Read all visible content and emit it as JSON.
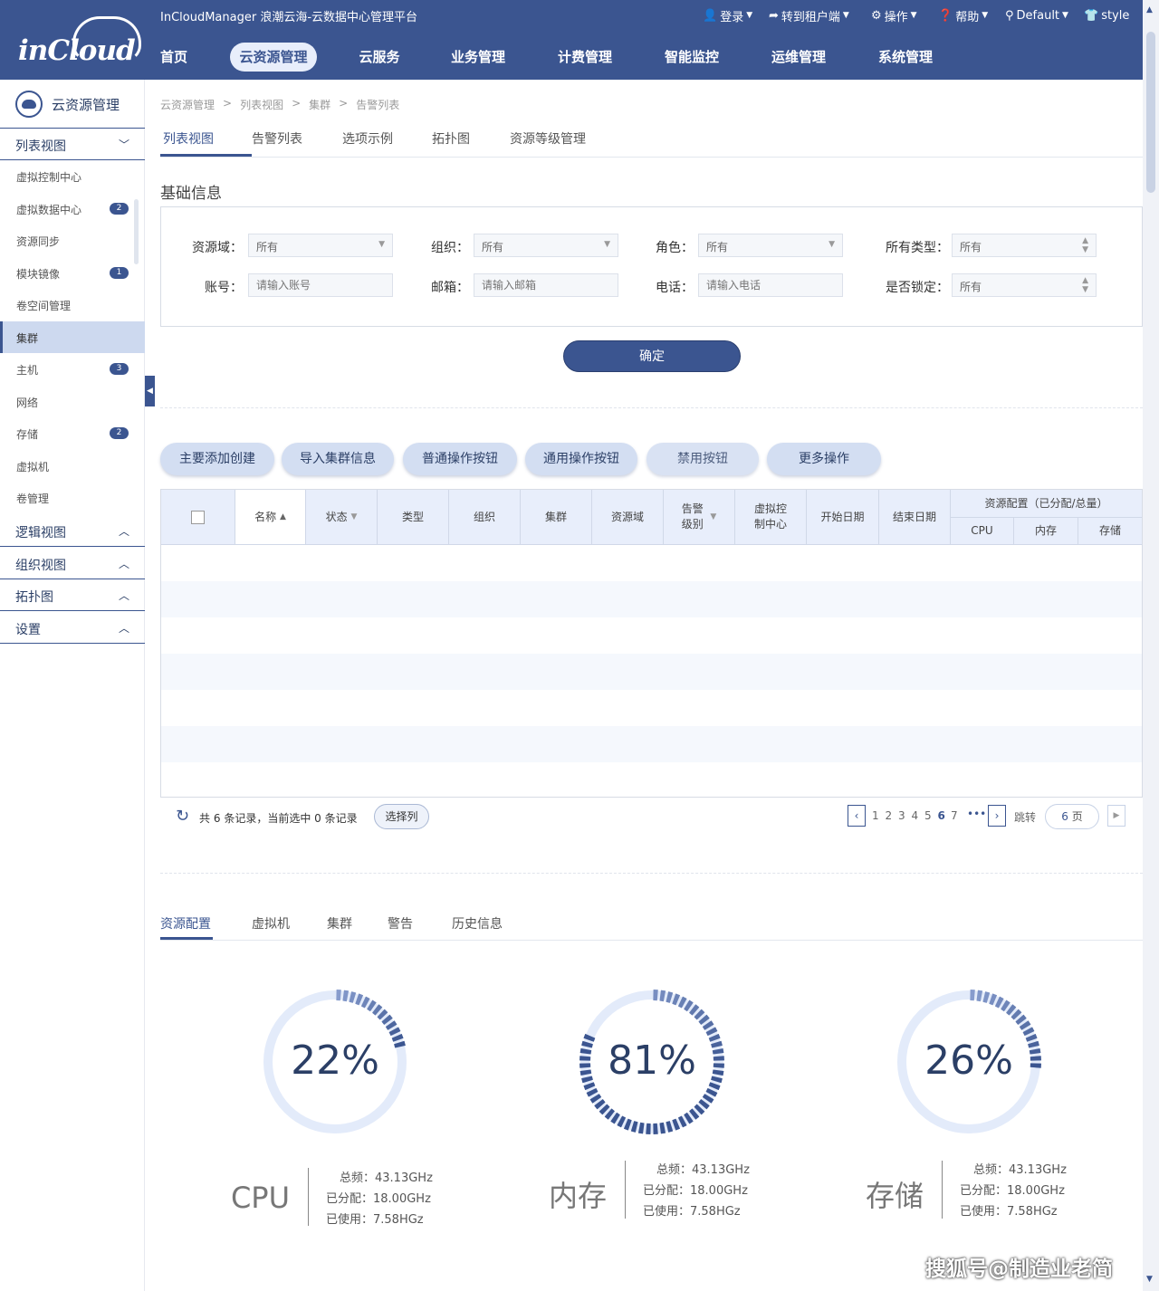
{
  "app": {
    "logo_text": "inCloud",
    "platform_title": "InCloudManager 浪潮云海-云数据中心管理平台"
  },
  "topbar": {
    "login": "登录",
    "tenant": "转到租户端",
    "ops": "操作",
    "help": "帮助",
    "location": "Default",
    "style": "style"
  },
  "mainnav": [
    "首页",
    "云资源管理",
    "云服务",
    "业务管理",
    "计费管理",
    "智能监控",
    "运维管理",
    "系统管理"
  ],
  "sidebar": {
    "title": "云资源管理",
    "list_view": "列表视图",
    "items": [
      {
        "label": "虚拟控制中心",
        "badge": ""
      },
      {
        "label": "虚拟数据中心",
        "badge": "2"
      },
      {
        "label": "资源同步",
        "badge": ""
      },
      {
        "label": "模块镜像",
        "badge": "1"
      },
      {
        "label": "卷空间管理",
        "badge": ""
      },
      {
        "label": "集群",
        "badge": ""
      },
      {
        "label": "主机",
        "badge": "3"
      },
      {
        "label": "网络",
        "badge": ""
      },
      {
        "label": "存储",
        "badge": "2"
      },
      {
        "label": "虚拟机",
        "badge": ""
      },
      {
        "label": "卷管理",
        "badge": ""
      }
    ],
    "sections": [
      "逻辑视图",
      "组织视图",
      "拓扑图",
      "设置"
    ]
  },
  "breadcrumb": [
    "云资源管理",
    ">",
    "列表视图",
    ">",
    "集群",
    ">",
    "告警列表"
  ],
  "tabs": [
    "列表视图",
    "告警列表",
    "选项示例",
    "拓扑图",
    "资源等级管理"
  ],
  "section_title": "基础信息",
  "filters": {
    "domain": {
      "label": "资源域：",
      "value": "所有"
    },
    "org": {
      "label": "组织：",
      "value": "所有"
    },
    "role": {
      "label": "角色：",
      "value": "所有"
    },
    "type": {
      "label": "所有类型：",
      "value": "所有"
    },
    "account": {
      "label": "账号：",
      "placeholder": "请输入账号"
    },
    "email": {
      "label": "邮箱：",
      "placeholder": "请输入邮箱"
    },
    "phone": {
      "label": "电话：",
      "placeholder": "请输入电话"
    },
    "locked": {
      "label": "是否锁定：",
      "value": "所有"
    }
  },
  "confirm_label": "确定",
  "op_buttons": [
    "主要添加创建",
    "导入集群信息",
    "普通操作按钮",
    "通用操作按钮",
    "禁用按钮",
    "更多操作"
  ],
  "table": {
    "headers": [
      "名称",
      "状态",
      "类型",
      "组织",
      "集群",
      "资源域",
      "告警\n级别",
      "虚拟控\n制中心",
      "开始日期",
      "结束日期"
    ],
    "group_header": "资源配置（已分配/总量）",
    "sub_headers": [
      "CPU",
      "内存",
      "存储"
    ]
  },
  "pager": {
    "summary_prefix": "共",
    "total": "6",
    "summary_mid": "条记录，当前选中",
    "selected": "0",
    "summary_suffix": "条记录",
    "choose_cols": "选择列",
    "pages": [
      "1",
      "2",
      "3",
      "4",
      "5",
      "6",
      "7"
    ],
    "current_page": "6",
    "ellipsis": "•••",
    "jump_label": "跳转",
    "jump_value": "6",
    "jump_unit": "页"
  },
  "res_tabs": [
    "资源配置",
    "虚拟机",
    "集群",
    "警告",
    "历史信息"
  ],
  "resources": [
    {
      "name": "CPU",
      "pct_text": "22%",
      "pct": 0.22,
      "total": "总频：43.13GHz",
      "alloc": "已分配：18.00GHz",
      "used": "已使用：7.58HGz"
    },
    {
      "name": "内存",
      "pct_text": "81%",
      "pct": 0.81,
      "total": "总频：43.13GHz",
      "alloc": "已分配：18.00GHz",
      "used": "已使用：7.58HGz"
    },
    {
      "name": "存储",
      "pct_text": "26%",
      "pct": 0.26,
      "total": "总频：43.13GHz",
      "alloc": "已分配：18.00GHz",
      "used": "已使用：7.58HGz"
    }
  ],
  "colors": {
    "brand": "#3b5590",
    "accent_light": "#e8eefb",
    "ring_bg": "#e3ebfa"
  },
  "watermark": "搜狐号@制造业老简"
}
